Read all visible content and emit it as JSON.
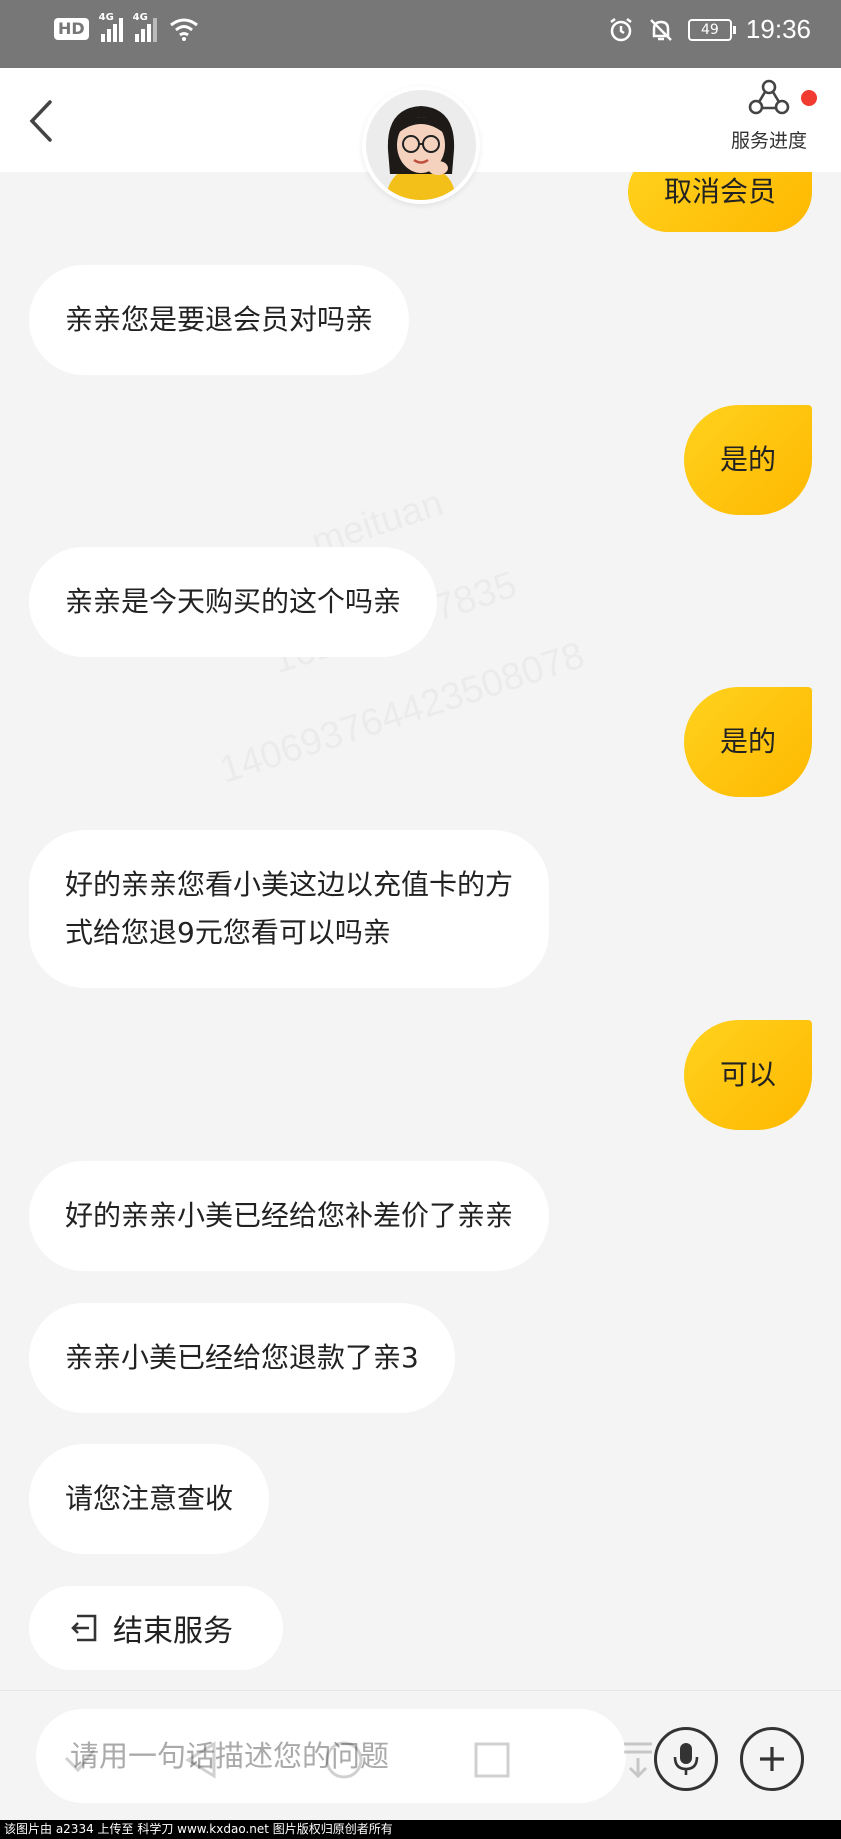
{
  "status_bar": {
    "hd": "HD",
    "network_1": "4G",
    "network_2": "4G",
    "battery": "49",
    "time": "19:36"
  },
  "header": {
    "back_icon": "chevron-left-icon",
    "progress_label": "服务进度",
    "progress_icon": "service-progress-icon",
    "has_notification": true
  },
  "messages": [
    {
      "side": "out",
      "text": "取消会员"
    },
    {
      "side": "in",
      "text": "亲亲您是要退会员对吗亲"
    },
    {
      "side": "out",
      "text": "是的"
    },
    {
      "side": "in",
      "text": "亲亲是今天购买的这个吗亲"
    },
    {
      "side": "out",
      "text": "是的"
    },
    {
      "side": "in",
      "line1": "好的亲亲您看小美这边以充值卡的方",
      "line2": "式给您退9元您看可以吗亲"
    },
    {
      "side": "out",
      "text": "可以"
    },
    {
      "side": "in",
      "text": "好的亲亲小美已经给您补差价了亲亲"
    },
    {
      "side": "in",
      "text": "亲亲小美已经给您退款了亲3"
    },
    {
      "side": "in",
      "text": "请您注意查收"
    }
  ],
  "watermark": {
    "line1": "meituan",
    "line2": "162477837835",
    "line3": "140693764423508078"
  },
  "end_service": {
    "label": "结束服务",
    "icon": "exit-icon"
  },
  "input": {
    "placeholder": "请用一句话描述您的问题",
    "voice_icon": "microphone-icon",
    "more_icon": "plus-icon"
  },
  "footer_credit": "该图片由 a2334 上传至 科学刀 www.kxdao.net 图片版权归原创者所有",
  "colors": {
    "accent": "#ffc400",
    "status_bar": "#777777",
    "notification": "#f23b30"
  }
}
